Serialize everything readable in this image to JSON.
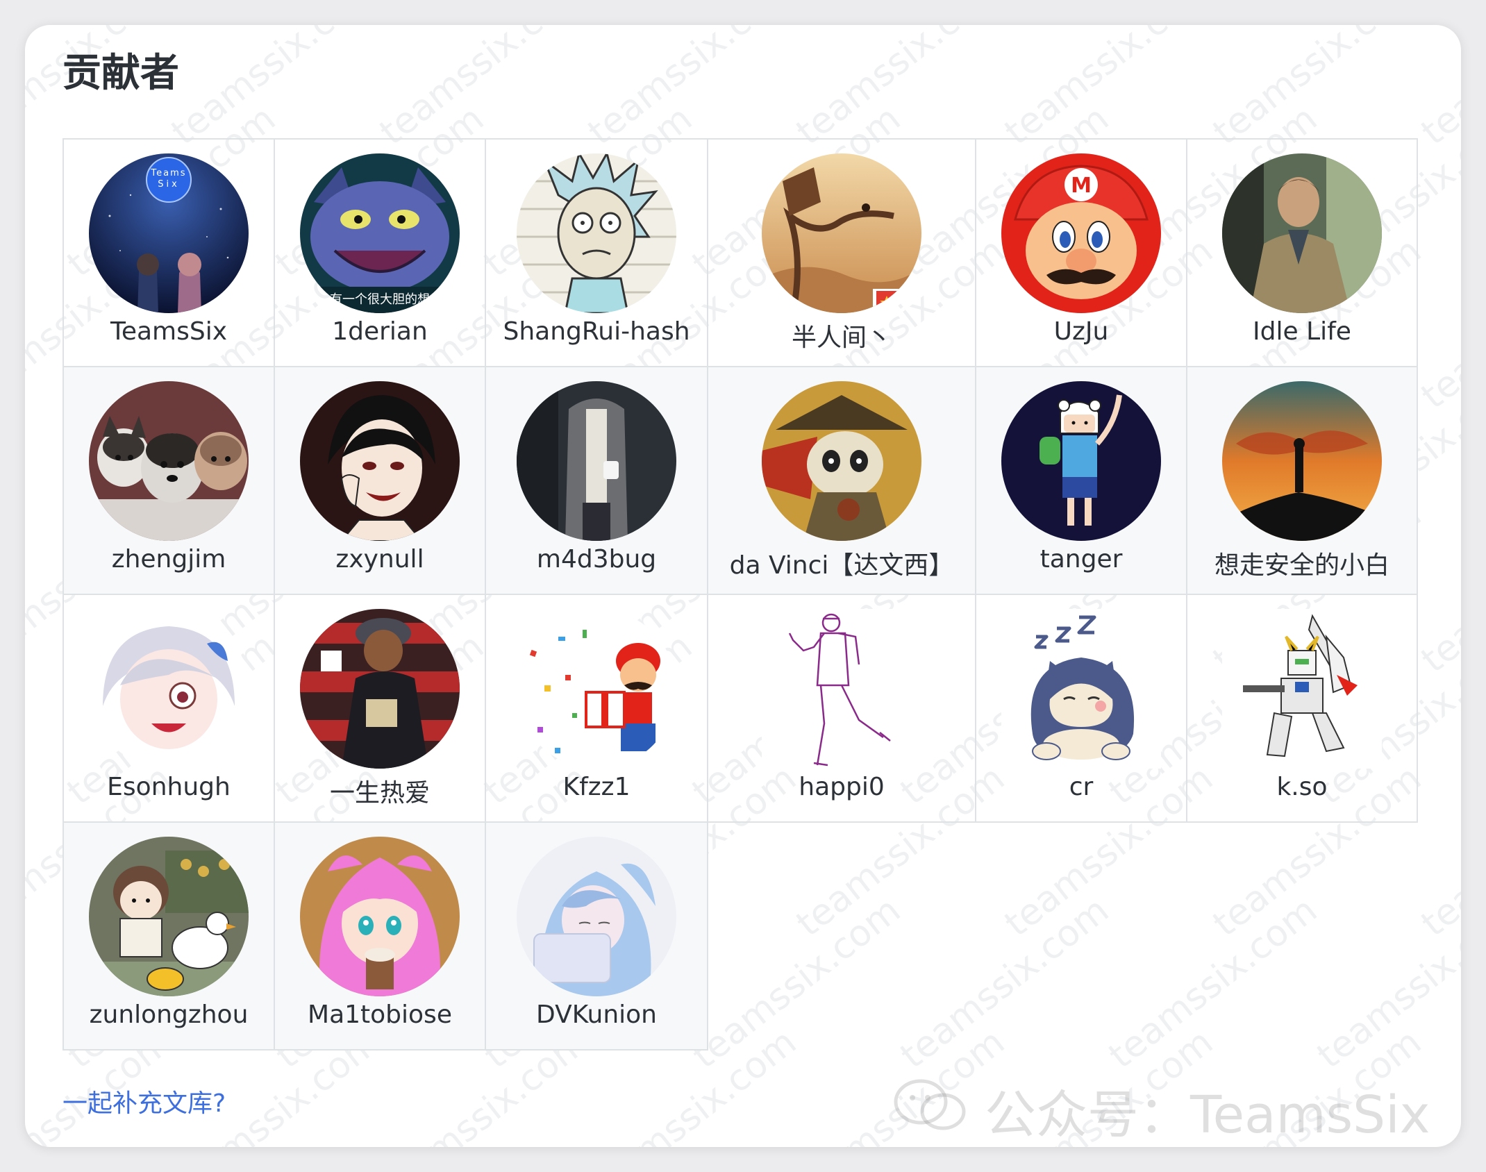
{
  "page": {
    "title": "贡献者",
    "footer_link": "一起补充文库?",
    "watermark_text": "teamssix.com",
    "wechat_mark": "公众号：TeamsSix"
  },
  "colors": {
    "link": "#3d6fde",
    "row_alt_bg": "#f6f8fa",
    "border": "#dfe2e5",
    "text": "#2c3138"
  },
  "contributors": [
    {
      "name": "TeamsSix",
      "avatar_icon": "night-sky-avatar-icon",
      "avatar_text": "Teams Six"
    },
    {
      "name": "1derian",
      "avatar_icon": "cartoon-cat-avatar-icon",
      "avatar_text": "有一个很大胆的想"
    },
    {
      "name": "ShangRui-hash",
      "avatar_icon": "rick-cartoon-avatar-icon"
    },
    {
      "name": "半人间丶",
      "avatar_icon": "treehouse-avatar-icon"
    },
    {
      "name": "UzJu",
      "avatar_icon": "mario-avatar-icon"
    },
    {
      "name": "Idle Life",
      "avatar_icon": "man-on-train-avatar-icon"
    },
    {
      "name": "zhengjim",
      "avatar_icon": "husky-puppies-avatar-icon"
    },
    {
      "name": "zxynull",
      "avatar_icon": "anime-boy-avatar-icon"
    },
    {
      "name": "m4d3bug",
      "avatar_icon": "man-with-cup-avatar-icon"
    },
    {
      "name": "da Vinci【达文西】",
      "avatar_icon": "panda-warrior-avatar-icon"
    },
    {
      "name": "tanger",
      "avatar_icon": "finn-cartoon-avatar-icon"
    },
    {
      "name": "想走安全的小白",
      "avatar_icon": "sunset-silhouette-avatar-icon"
    },
    {
      "name": "Esonhugh",
      "avatar_icon": "anime-girl-avatar-icon"
    },
    {
      "name": "一生热爱",
      "avatar_icon": "man-in-store-avatar-icon"
    },
    {
      "name": "Kfzz1",
      "avatar_icon": "mario-gift-avatar-icon"
    },
    {
      "name": "happi0",
      "avatar_icon": "line-drawing-person-avatar-icon"
    },
    {
      "name": "cr",
      "avatar_icon": "snorlax-avatar-icon"
    },
    {
      "name": "k.so",
      "avatar_icon": "gundam-robot-avatar-icon"
    },
    {
      "name": "zunlongzhou",
      "avatar_icon": "kid-with-ducks-avatar-icon"
    },
    {
      "name": "Ma1tobiose",
      "avatar_icon": "pink-hair-girl-avatar-icon"
    },
    {
      "name": "DVKunion",
      "avatar_icon": "blue-hair-girl-avatar-icon"
    }
  ]
}
